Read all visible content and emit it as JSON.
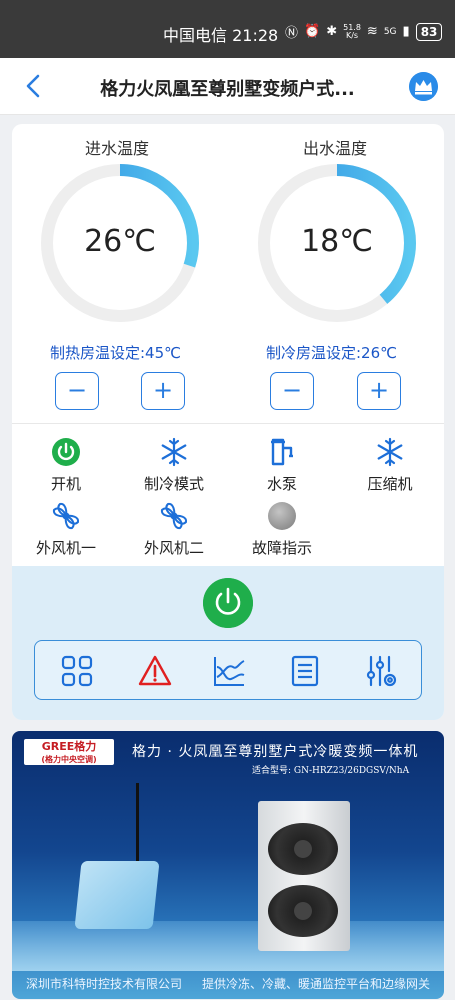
{
  "status_bar": {
    "carrier": "中国电信",
    "time": "21:28",
    "speed_top": "51.8",
    "speed_bottom": "K/s",
    "network": "5G",
    "battery": "83"
  },
  "header": {
    "title": "格力火凤凰至尊别墅变频户式..."
  },
  "gauges": [
    {
      "label": "进水温度",
      "value": "26℃",
      "fill_fraction": 0.3,
      "setpoint": "制热房温设定:45℃"
    },
    {
      "label": "出水温度",
      "value": "18℃",
      "fill_fraction": 0.39,
      "setpoint": "制冷房温设定:26℃"
    }
  ],
  "stepper": {
    "minus": "−",
    "plus": "+"
  },
  "status_items": [
    {
      "label": "开机",
      "icon": "power-on-icon"
    },
    {
      "label": "制冷模式",
      "icon": "snowflake-icon"
    },
    {
      "label": "水泵",
      "icon": "water-pump-icon"
    },
    {
      "label": "压缩机",
      "icon": "snowflake-icon"
    },
    {
      "label": "外风机一",
      "icon": "fan-icon"
    },
    {
      "label": "外风机二",
      "icon": "fan-icon"
    },
    {
      "label": "故障指示",
      "icon": "fault-indicator-icon"
    }
  ],
  "toolbar": {
    "tools": [
      "grid-icon",
      "warning-icon",
      "chart-icon",
      "list-icon",
      "settings-sliders-icon"
    ]
  },
  "banner": {
    "logo": "GREE格力",
    "logo_sub": "(格力中央空调)",
    "title": "格力 · 火凤凰至尊别墅户式冷暖变频一体机",
    "model": "适合型号: GN-HRZ23/26DGSV/NhA",
    "footer_left": "深圳市科特时控技术有限公司",
    "footer_right": "提供冷冻、冷藏、暖通监控平台和边缘网关"
  },
  "colors": {
    "accent": "#2a7de0",
    "gauge_track": "#eeeeee",
    "gauge_arc_start": "#2a8be0",
    "gauge_arc_end": "#5ac8f0",
    "power_green": "#1fae4b",
    "fault_gray": "#9a9a9a",
    "setpoint_blue": "#1b56c7"
  }
}
